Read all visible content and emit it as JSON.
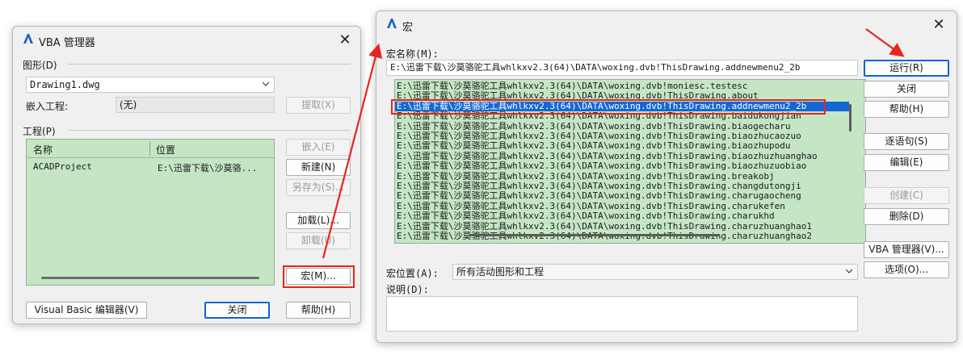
{
  "vba_manager": {
    "title": "VBA 管理器",
    "drawing_label": "图形(D)",
    "drawing_value": "Drawing1.dwg",
    "embedded_label": "嵌入工程:",
    "embedded_value": "(无)",
    "extract_button": "提取(X)",
    "project_label": "工程(P)",
    "columns": [
      "名称",
      "位置"
    ],
    "projects": [
      {
        "name": "ACADProject",
        "location": "E:\\迅雷下载\\沙莫骆..."
      }
    ],
    "embed_button": "嵌入(E)",
    "new_button": "新建(N)",
    "saveas_button": "另存为(S)...",
    "load_button": "加载(L)...",
    "unload_button": "卸载(U)",
    "macro_button": "宏(M)...",
    "vb_editor_button": "Visual Basic 编辑器(V)",
    "close_button": "关闭",
    "help_button": "帮助(H)"
  },
  "macro_dialog": {
    "title": "宏",
    "macro_name_label": "宏名称(M):",
    "macro_name_value": "E:\\迅雷下载\\沙莫骆驼工具whlkxv2.3(64)\\DATA\\woxing.dvb!ThisDrawing.addnewmenu2_2b",
    "macros": [
      "E:\\迅雷下载\\沙莫骆驼工具whlkxv2.3(64)\\DATA\\woxing.dvb!moniesc.testesc",
      "E:\\迅雷下载\\沙莫骆驼工具whlkxv2.3(64)\\DATA\\woxing.dvb!ThisDrawing.about",
      "E:\\迅雷下载\\沙莫骆驼工具whlkxv2.3(64)\\DATA\\woxing.dvb!ThisDrawing.addnewmenu2_2b",
      "E:\\迅雷下载\\沙莫骆驼工具whlkxv2.3(64)\\DATA\\woxing.dvb!ThisDrawing.baidukongjian",
      "E:\\迅雷下载\\沙莫骆驼工具whlkxv2.3(64)\\DATA\\woxing.dvb!ThisDrawing.biaogecharu",
      "E:\\迅雷下载\\沙莫骆驼工具whlkxv2.3(64)\\DATA\\woxing.dvb!ThisDrawing.biaozhucaozuo",
      "E:\\迅雷下载\\沙莫骆驼工具whlkxv2.3(64)\\DATA\\woxing.dvb!ThisDrawing.biaozhupodu",
      "E:\\迅雷下载\\沙莫骆驼工具whlkxv2.3(64)\\DATA\\woxing.dvb!ThisDrawing.biaozhuzhuanghao",
      "E:\\迅雷下载\\沙莫骆驼工具whlkxv2.3(64)\\DATA\\woxing.dvb!ThisDrawing.biaozhuzuobiao",
      "E:\\迅雷下载\\沙莫骆驼工具whlkxv2.3(64)\\DATA\\woxing.dvb!ThisDrawing.breakobj",
      "E:\\迅雷下载\\沙莫骆驼工具whlkxv2.3(64)\\DATA\\woxing.dvb!ThisDrawing.changdutongji",
      "E:\\迅雷下载\\沙莫骆驼工具whlkxv2.3(64)\\DATA\\woxing.dvb!ThisDrawing.charugaocheng",
      "E:\\迅雷下载\\沙莫骆驼工具whlkxv2.3(64)\\DATA\\woxing.dvb!ThisDrawing.charukefen",
      "E:\\迅雷下载\\沙莫骆驼工具whlkxv2.3(64)\\DATA\\woxing.dvb!ThisDrawing.charukhd",
      "E:\\迅雷下载\\沙莫骆驼工具whlkxv2.3(64)\\DATA\\woxing.dvb!ThisDrawing.charuzhuanghao1",
      "E:\\迅雷下载\\沙莫骆驼工具whlkxv2.3(64)\\DATA\\woxing.dvb!ThisDrawing.charuzhuanghao2"
    ],
    "selected_index": 2,
    "run_button": "运行(R)",
    "close_button": "关闭",
    "help_button": "帮助(H)",
    "step_into_button": "逐语句(S)",
    "edit_button": "编辑(E)",
    "create_button": "创建(C)",
    "delete_button": "删除(D)",
    "vba_manager_button": "VBA 管理器(V)...",
    "options_button": "选项(O)...",
    "macro_location_label": "宏位置(A):",
    "macro_location_value": "所有活动图形和工程",
    "description_label": "说明(D):",
    "description_value": ""
  },
  "colors": {
    "annotation": "#e8241e",
    "selection": "#1568d4",
    "list_background": "#c4e6c4",
    "logo": "#1f5fbf"
  },
  "icons": {
    "logo": "autocad-a-logo",
    "close": "close-icon",
    "dropdown": "chevron-down-icon"
  }
}
